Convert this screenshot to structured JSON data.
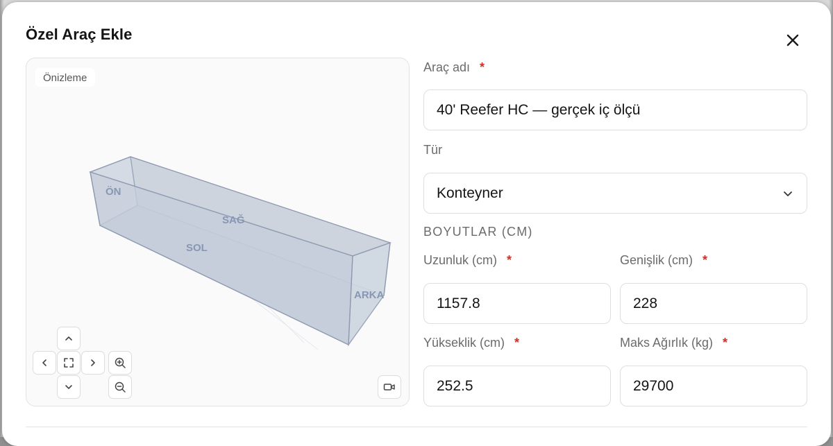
{
  "modal": {
    "title": "Özel Araç Ekle",
    "close_icon": "close-icon"
  },
  "preview": {
    "label": "Önizleme",
    "faces": {
      "front": "ÖN",
      "right": "SAĞ",
      "left": "SOL",
      "back": "ARKA"
    },
    "controls": [
      "chevron-up-icon",
      "chevron-left-icon",
      "fit-view-icon",
      "chevron-right-icon",
      "chevron-down-icon",
      "zoom-in-icon",
      "zoom-out-icon",
      "camera-icon"
    ]
  },
  "form": {
    "name": {
      "label": "Araç adı",
      "required": "*",
      "value": "40' Reefer HC — gerçek iç ölçü"
    },
    "type": {
      "label": "Tür",
      "value": "Konteyner"
    },
    "dimensions_title": "BOYUTLAR (CM)",
    "length": {
      "label": "Uzunluk (cm)",
      "required": "*",
      "value": "1157.8"
    },
    "width": {
      "label": "Genişlik (cm)",
      "required": "*",
      "value": "228"
    },
    "height": {
      "label": "Yükseklik (cm)",
      "required": "*",
      "value": "252.5"
    },
    "max_weight": {
      "label": "Maks Ağırlık (kg)",
      "required": "*",
      "value": "29700"
    }
  },
  "colors": {
    "required": "#d0302b",
    "box_fill": "#cfd6e0",
    "box_edge": "#9aa6bb",
    "face_label": "#8797b3"
  }
}
